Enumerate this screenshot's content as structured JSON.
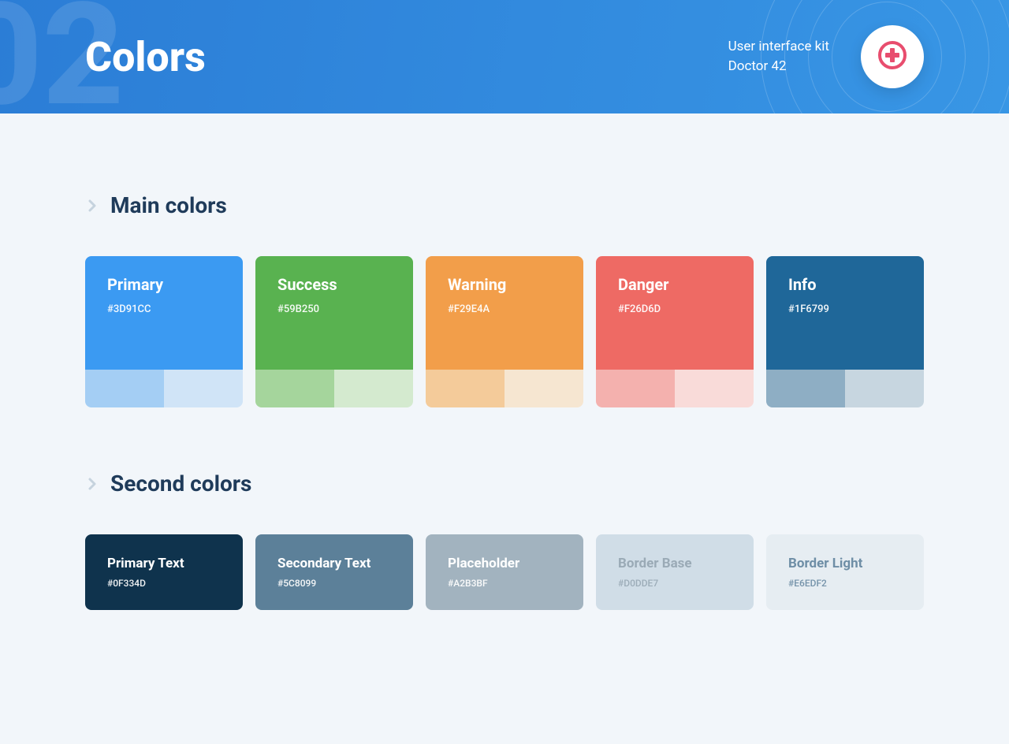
{
  "header": {
    "title": "Colors",
    "meta_line1": "User interface kit",
    "meta_line2": "Doctor 42"
  },
  "sections": {
    "s1": {
      "title": "Main colors"
    },
    "s2": {
      "title": "Second colors"
    }
  },
  "main_colors": [
    {
      "name": "Primary",
      "hex": "#3D91CC",
      "color": "#3B9AF2",
      "tint1": "#A4CEF4",
      "tint2": "#D0E4F7"
    },
    {
      "name": "Success",
      "hex": "#59B250",
      "color": "#59B250",
      "tint1": "#A5D59C",
      "tint2": "#D4EACF"
    },
    {
      "name": "Warning",
      "hex": "#F29E4A",
      "color": "#F29E4A",
      "tint1": "#F4CB9A",
      "tint2": "#F6E6D1"
    },
    {
      "name": "Danger",
      "hex": "#F26D6D",
      "color": "#EE6A64",
      "tint1": "#F4B1AE",
      "tint2": "#F9DBD9"
    },
    {
      "name": "Info",
      "hex": "#1F6799",
      "color": "#1F6799",
      "tint1": "#8EAEC4",
      "tint2": "#C7D6E0"
    }
  ],
  "second_colors": [
    {
      "name": "Primary Text",
      "hex": "#0F334D",
      "color": "#0F334D",
      "text": "#FFFFFF"
    },
    {
      "name": "Secondary Text",
      "hex": "#5C8099",
      "color": "#5C8099",
      "text": "#FFFFFF"
    },
    {
      "name": "Placeholder",
      "hex": "#A2B3BF",
      "color": "#A2B3BF",
      "text": "#FFFFFF"
    },
    {
      "name": "Border Base",
      "hex": "#D0DDE7",
      "color": "#D0DDE7",
      "text": "#9AAAB6"
    },
    {
      "name": "Border Light",
      "hex": "#E6EDF2",
      "color": "#E6EDF2",
      "text": "#6E8EA6"
    }
  ]
}
